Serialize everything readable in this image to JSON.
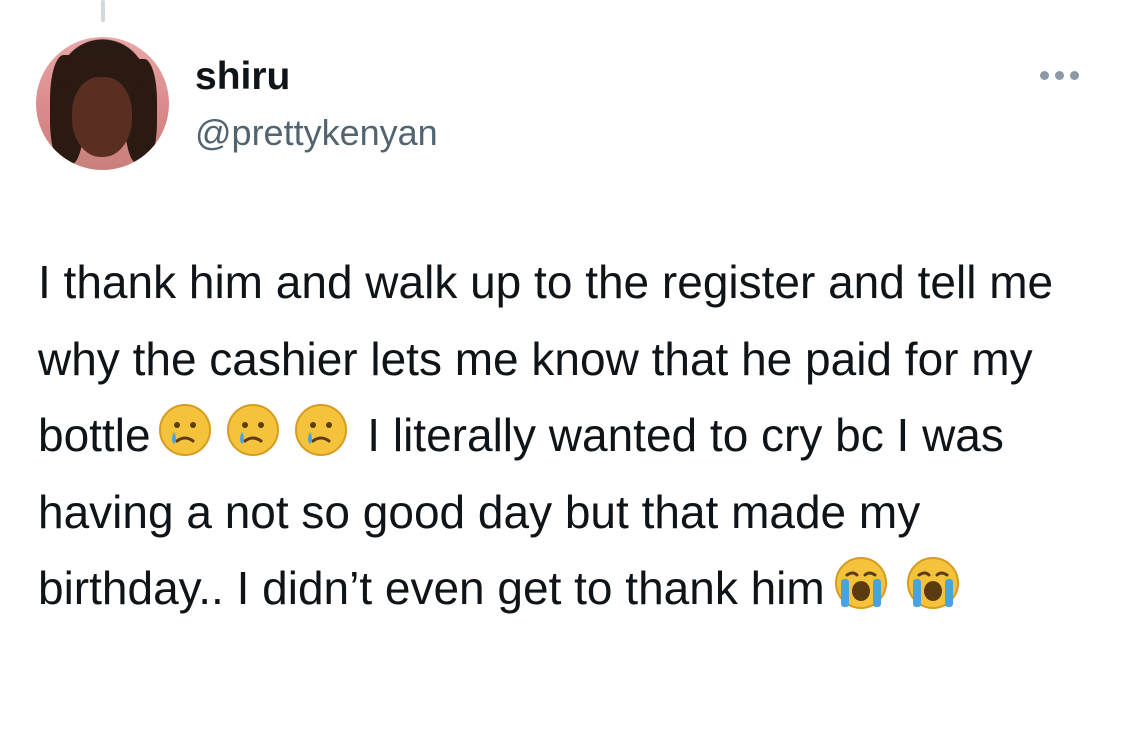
{
  "tweet": {
    "name": "shiru",
    "handle": "@prettykenyan",
    "text_part1": "I thank him and walk up to the register and tell me why the cashier lets me know that he paid for my bottle",
    "text_part2": " I literally wanted to cry bc I was having a not so good day but that made my birthday.. I didn’t even get to thank him",
    "emojis_1": [
      "sad-tear-face",
      "sad-tear-face",
      "sad-tear-face"
    ],
    "emojis_2": [
      "loudly-crying-face",
      "loudly-crying-face"
    ]
  },
  "colors": {
    "text": "#0f1419",
    "secondary": "#536471",
    "emoji_yellow": "#f5c33b",
    "tear_blue": "#4aa3df"
  }
}
